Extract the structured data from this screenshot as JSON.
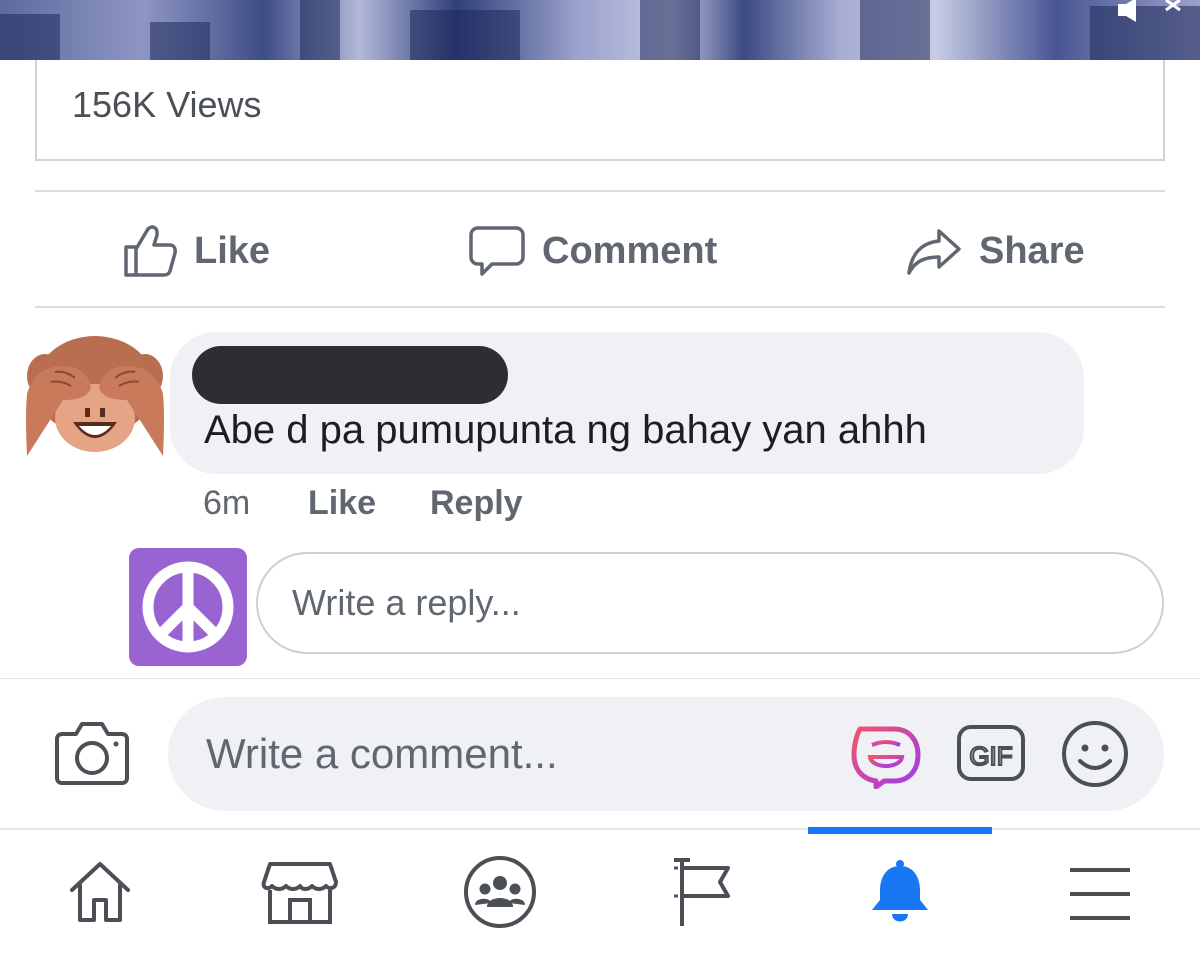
{
  "post": {
    "views_text": "156K Views",
    "actions": {
      "like_label": "Like",
      "comment_label": "Comment",
      "share_label": "Share"
    }
  },
  "comment": {
    "text": "Abe d pa pumupunta ng bahay yan ahhh",
    "time": "6m",
    "like_label": "Like",
    "reply_label": "Reply",
    "avatar_icon": "see-no-evil-monkey-icon"
  },
  "reply_box": {
    "placeholder": "Write a reply...",
    "avatar_icon": "peace-symbol-icon"
  },
  "comment_box": {
    "placeholder": "Write a comment...",
    "icons": [
      "camera-icon",
      "avatar-sticker-icon",
      "gif-icon",
      "emoji-icon"
    ],
    "gif_label": "GIF"
  },
  "bottom_nav": {
    "items": [
      "home-icon",
      "marketplace-icon",
      "groups-icon",
      "pages-flag-icon",
      "notifications-bell-icon",
      "menu-icon"
    ],
    "active": "notifications-bell-icon"
  },
  "colors": {
    "accent": "#1877f2",
    "text_secondary": "#606770",
    "bubble_bg": "#f0f1f4",
    "peace_bg": "#9a63d2",
    "monkey": "#c87a5a"
  }
}
